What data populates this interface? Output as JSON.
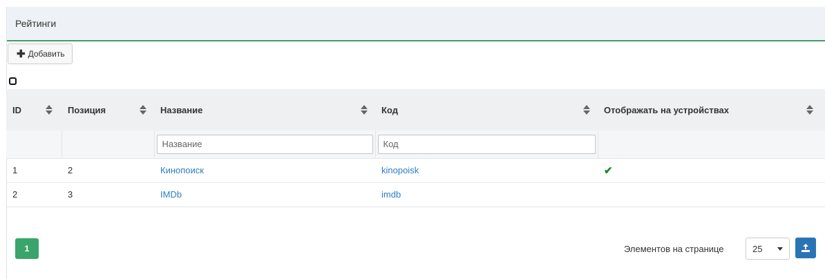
{
  "panel": {
    "title": "Рейтинги"
  },
  "toolbar": {
    "add_label": "Добавить",
    "add_icon": "plus-icon"
  },
  "table": {
    "columns": [
      {
        "key": "id",
        "label": "ID",
        "sortable": true
      },
      {
        "key": "position",
        "label": "Позиция",
        "sortable": true
      },
      {
        "key": "name",
        "label": "Название",
        "sortable": true
      },
      {
        "key": "code",
        "label": "Код",
        "sortable": true
      },
      {
        "key": "show_on_devices",
        "label": "Отображать на устройствах",
        "sortable": true
      }
    ],
    "filters": {
      "name_placeholder": "Название",
      "code_placeholder": "Код"
    },
    "rows": [
      {
        "id": "1",
        "position": "2",
        "name": "Кинопоиск",
        "code": "kinopoisk",
        "show_on_devices": true
      },
      {
        "id": "2",
        "position": "3",
        "name": "IMDb",
        "code": "imdb",
        "show_on_devices": false
      }
    ]
  },
  "pagination": {
    "current_page": "1"
  },
  "footer": {
    "per_page_label": "Элементов на странице",
    "per_page_value": "25",
    "export_icon": "export-icon"
  },
  "colors": {
    "accent": "#3aa56b",
    "link": "#2a7fc4",
    "check": "#1a8a1a",
    "export": "#2a74b6"
  }
}
